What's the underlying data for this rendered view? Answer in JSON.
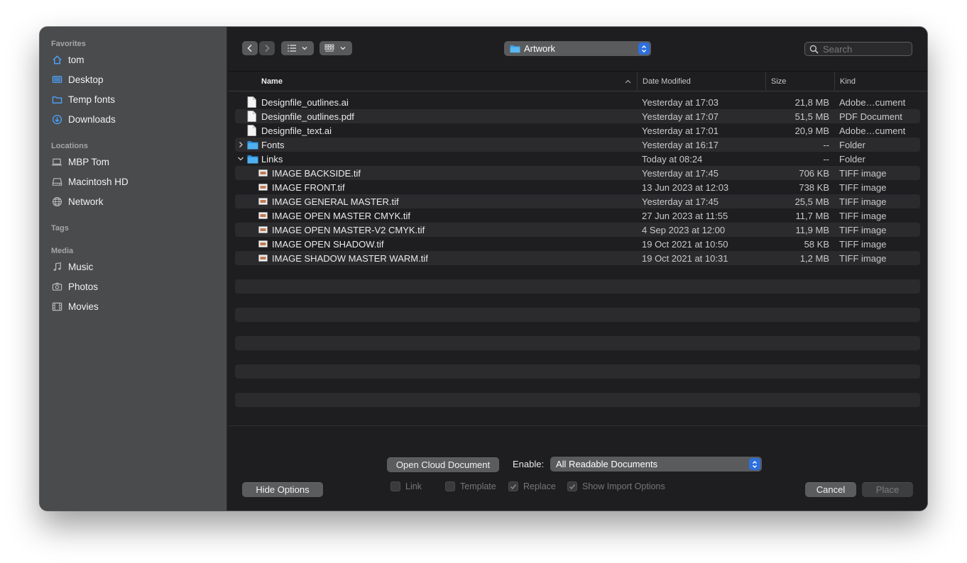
{
  "sidebar": {
    "sections": {
      "favorites": "Favorites",
      "locations": "Locations",
      "tags": "Tags",
      "media": "Media"
    },
    "favorites": [
      {
        "label": "tom",
        "icon": "home-icon"
      },
      {
        "label": "Desktop",
        "icon": "desktop-icon"
      },
      {
        "label": "Temp fonts",
        "icon": "folder-icon"
      },
      {
        "label": "Downloads",
        "icon": "download-icon"
      }
    ],
    "locations": [
      {
        "label": "MBP Tom",
        "icon": "laptop-icon"
      },
      {
        "label": "Macintosh HD",
        "icon": "disk-icon"
      },
      {
        "label": "Network",
        "icon": "globe-icon"
      }
    ],
    "media": [
      {
        "label": "Music",
        "icon": "music-icon"
      },
      {
        "label": "Photos",
        "icon": "camera-icon"
      },
      {
        "label": "Movies",
        "icon": "film-icon"
      }
    ]
  },
  "toolbar": {
    "path": "Artwork",
    "search_placeholder": "Search"
  },
  "columns": {
    "name": "Name",
    "date": "Date Modified",
    "size": "Size",
    "kind": "Kind"
  },
  "files": [
    {
      "name": "Designfile_outlines.ai",
      "date": "Yesterday at 17:03",
      "size": "21,8 MB",
      "kind": "Adobe…cument",
      "type": "doc",
      "indent": 0
    },
    {
      "name": "Designfile_outlines.pdf",
      "date": "Yesterday at 17:07",
      "size": "51,5 MB",
      "kind": "PDF Document",
      "type": "doc",
      "indent": 0
    },
    {
      "name": "Designfile_text.ai",
      "date": "Yesterday at 17:01",
      "size": "20,9 MB",
      "kind": "Adobe…cument",
      "type": "doc",
      "indent": 0
    },
    {
      "name": "Fonts",
      "date": "Yesterday at 16:17",
      "size": "--",
      "kind": "Folder",
      "type": "folder-closed",
      "indent": 0
    },
    {
      "name": "Links",
      "date": "Today at 08:24",
      "size": "--",
      "kind": "Folder",
      "type": "folder-open",
      "indent": 0
    },
    {
      "name": "IMAGE BACKSIDE.tif",
      "date": "Yesterday at 17:45",
      "size": "706 KB",
      "kind": "TIFF image",
      "type": "image",
      "indent": 1
    },
    {
      "name": "IMAGE FRONT.tif",
      "date": "13 Jun 2023 at 12:03",
      "size": "738 KB",
      "kind": "TIFF image",
      "type": "image",
      "indent": 1
    },
    {
      "name": "IMAGE GENERAL MASTER.tif",
      "date": "Yesterday at 17:45",
      "size": "25,5 MB",
      "kind": "TIFF image",
      "type": "image",
      "indent": 1
    },
    {
      "name": "IMAGE OPEN MASTER CMYK.tif",
      "date": "27 Jun 2023 at 11:55",
      "size": "11,7 MB",
      "kind": "TIFF image",
      "type": "image",
      "indent": 1
    },
    {
      "name": "IMAGE OPEN MASTER-V2 CMYK.tif",
      "date": "4 Sep 2023 at 12:00",
      "size": "11,9 MB",
      "kind": "TIFF image",
      "type": "image",
      "indent": 1
    },
    {
      "name": "IMAGE OPEN SHADOW.tif",
      "date": "19 Oct 2021 at 10:50",
      "size": "58 KB",
      "kind": "TIFF image",
      "type": "image",
      "indent": 1
    },
    {
      "name": "IMAGE SHADOW MASTER WARM.tif",
      "date": "19 Oct 2021 at 10:31",
      "size": "1,2 MB",
      "kind": "TIFF image",
      "type": "image",
      "indent": 1
    }
  ],
  "options": {
    "open_cloud": "Open Cloud Document",
    "enable_label": "Enable:",
    "enable_value": "All Readable Documents",
    "checkboxes": [
      {
        "label": "Link",
        "checked": false
      },
      {
        "label": "Template",
        "checked": false
      },
      {
        "label": "Replace",
        "checked": true
      },
      {
        "label": "Show Import Options",
        "checked": true
      }
    ]
  },
  "footer": {
    "hide_options": "Hide Options",
    "cancel": "Cancel",
    "place": "Place"
  },
  "colors": {
    "accent": "#2e6fde",
    "folder": "#3aa0e8",
    "sidebar_icon": "#4da3ff"
  }
}
